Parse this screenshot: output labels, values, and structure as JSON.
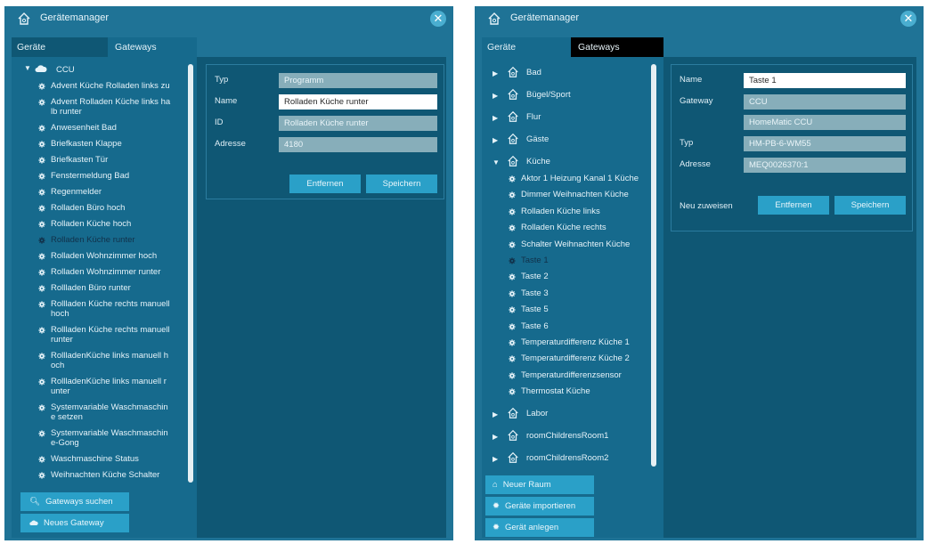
{
  "colors": {
    "window_bg": "#1f7396",
    "panel_bg": "#166a8d",
    "detail_bg": "#0f5774",
    "button": "#2aa0c8",
    "field": "#87aeba",
    "close": "#4aaed0"
  },
  "left_window": {
    "title": "Gerätemanager",
    "tabs": [
      {
        "label": "Geräte",
        "active": false
      },
      {
        "label": "Gateways",
        "active": true
      }
    ],
    "gateway": "CCU",
    "devices": [
      {
        "lines": [
          "Advent Küche Rolladen links zu"
        ]
      },
      {
        "lines": [
          "Advent Rolladen Küche links ha",
          "lb runter"
        ]
      },
      {
        "lines": [
          "Anwesenheit Bad"
        ]
      },
      {
        "lines": [
          "Briefkasten Klappe"
        ]
      },
      {
        "lines": [
          "Briefkasten Tür"
        ]
      },
      {
        "lines": [
          "Fenstermeldung Bad"
        ]
      },
      {
        "lines": [
          "Regenmelder"
        ]
      },
      {
        "lines": [
          "Rolladen Büro hoch"
        ]
      },
      {
        "lines": [
          "Rolladen Küche hoch"
        ]
      },
      {
        "lines": [
          "Rolladen Küche runter"
        ],
        "selected": true
      },
      {
        "lines": [
          "Rolladen Wohnzimmer hoch"
        ]
      },
      {
        "lines": [
          "Rolladen Wohnzimmer runter"
        ]
      },
      {
        "lines": [
          "Rollladen Büro runter"
        ]
      },
      {
        "lines": [
          "Rollladen Küche rechts manuell",
          "hoch"
        ]
      },
      {
        "lines": [
          "Rollladen Küche rechts manuell",
          "runter"
        ]
      },
      {
        "lines": [
          "RollladenKüche links manuell h",
          "och"
        ]
      },
      {
        "lines": [
          "RollladenKüche links manuell r",
          "unter"
        ]
      },
      {
        "lines": [
          "Systemvariable Waschmaschin",
          "e setzen"
        ]
      },
      {
        "lines": [
          "Systemvariable Waschmaschin",
          "e-Gong"
        ]
      },
      {
        "lines": [
          "Waschmaschine Status"
        ]
      },
      {
        "lines": [
          "Weihnachten Küche Schalter"
        ]
      }
    ],
    "buttons": {
      "search_gateways": "Gateways suchen",
      "new_gateway": "Neues Gateway"
    },
    "details": {
      "typ_label": "Typ",
      "typ_value": "Programm",
      "name_label": "Name",
      "name_value": "Rolladen Küche runter",
      "id_label": "ID",
      "id_value": "Rolladen Küche runter",
      "address_label": "Adresse",
      "address_value": "4180",
      "remove": "Entfernen",
      "save": "Speichern"
    }
  },
  "right_window": {
    "title": "Gerätemanager",
    "tabs": [
      {
        "label": "Geräte",
        "active": true
      },
      {
        "label": "Gateways",
        "active": false
      }
    ],
    "rooms_top": [
      "Bad",
      "Bügel/Sport",
      "Flur",
      "Gäste"
    ],
    "expanded_room": "Küche",
    "kitchen_devices": [
      {
        "label": "Aktor 1 Heizung Kanal 1 Küche"
      },
      {
        "label": "Dimmer Weihnachten Küche"
      },
      {
        "label": "Rolladen Küche links"
      },
      {
        "label": "Rolladen Küche rechts"
      },
      {
        "label": "Schalter Weihnachten Küche"
      },
      {
        "label": "Taste 1",
        "selected": true
      },
      {
        "label": "Taste 2"
      },
      {
        "label": "Taste 3"
      },
      {
        "label": "Taste 5"
      },
      {
        "label": "Taste 6"
      },
      {
        "label": "Temperaturdifferenz Küche 1"
      },
      {
        "label": "Temperaturdifferenz Küche 2"
      },
      {
        "label": "Temperaturdifferenzsensor"
      },
      {
        "label": "Thermostat Küche"
      }
    ],
    "rooms_bottom": [
      "Labor",
      "roomChildrensRoom1",
      "roomChildrensRoom2"
    ],
    "buttons": {
      "new_room": "Neuer Raum",
      "import_devices": "Geräte importieren",
      "create_device": "Gerät anlegen"
    },
    "details": {
      "name_label": "Name",
      "name_value": "Taste 1",
      "gateway_label": "Gateway",
      "gateway_value": "CCU",
      "gateway_value2": "HomeMatic CCU",
      "typ_label": "Typ",
      "typ_value": "HM-PB-6-WM55",
      "address_label": "Adresse",
      "address_value": "MEQ0026370:1",
      "reassign": "Neu zuweisen",
      "remove": "Entfernen",
      "save": "Speichern"
    }
  }
}
